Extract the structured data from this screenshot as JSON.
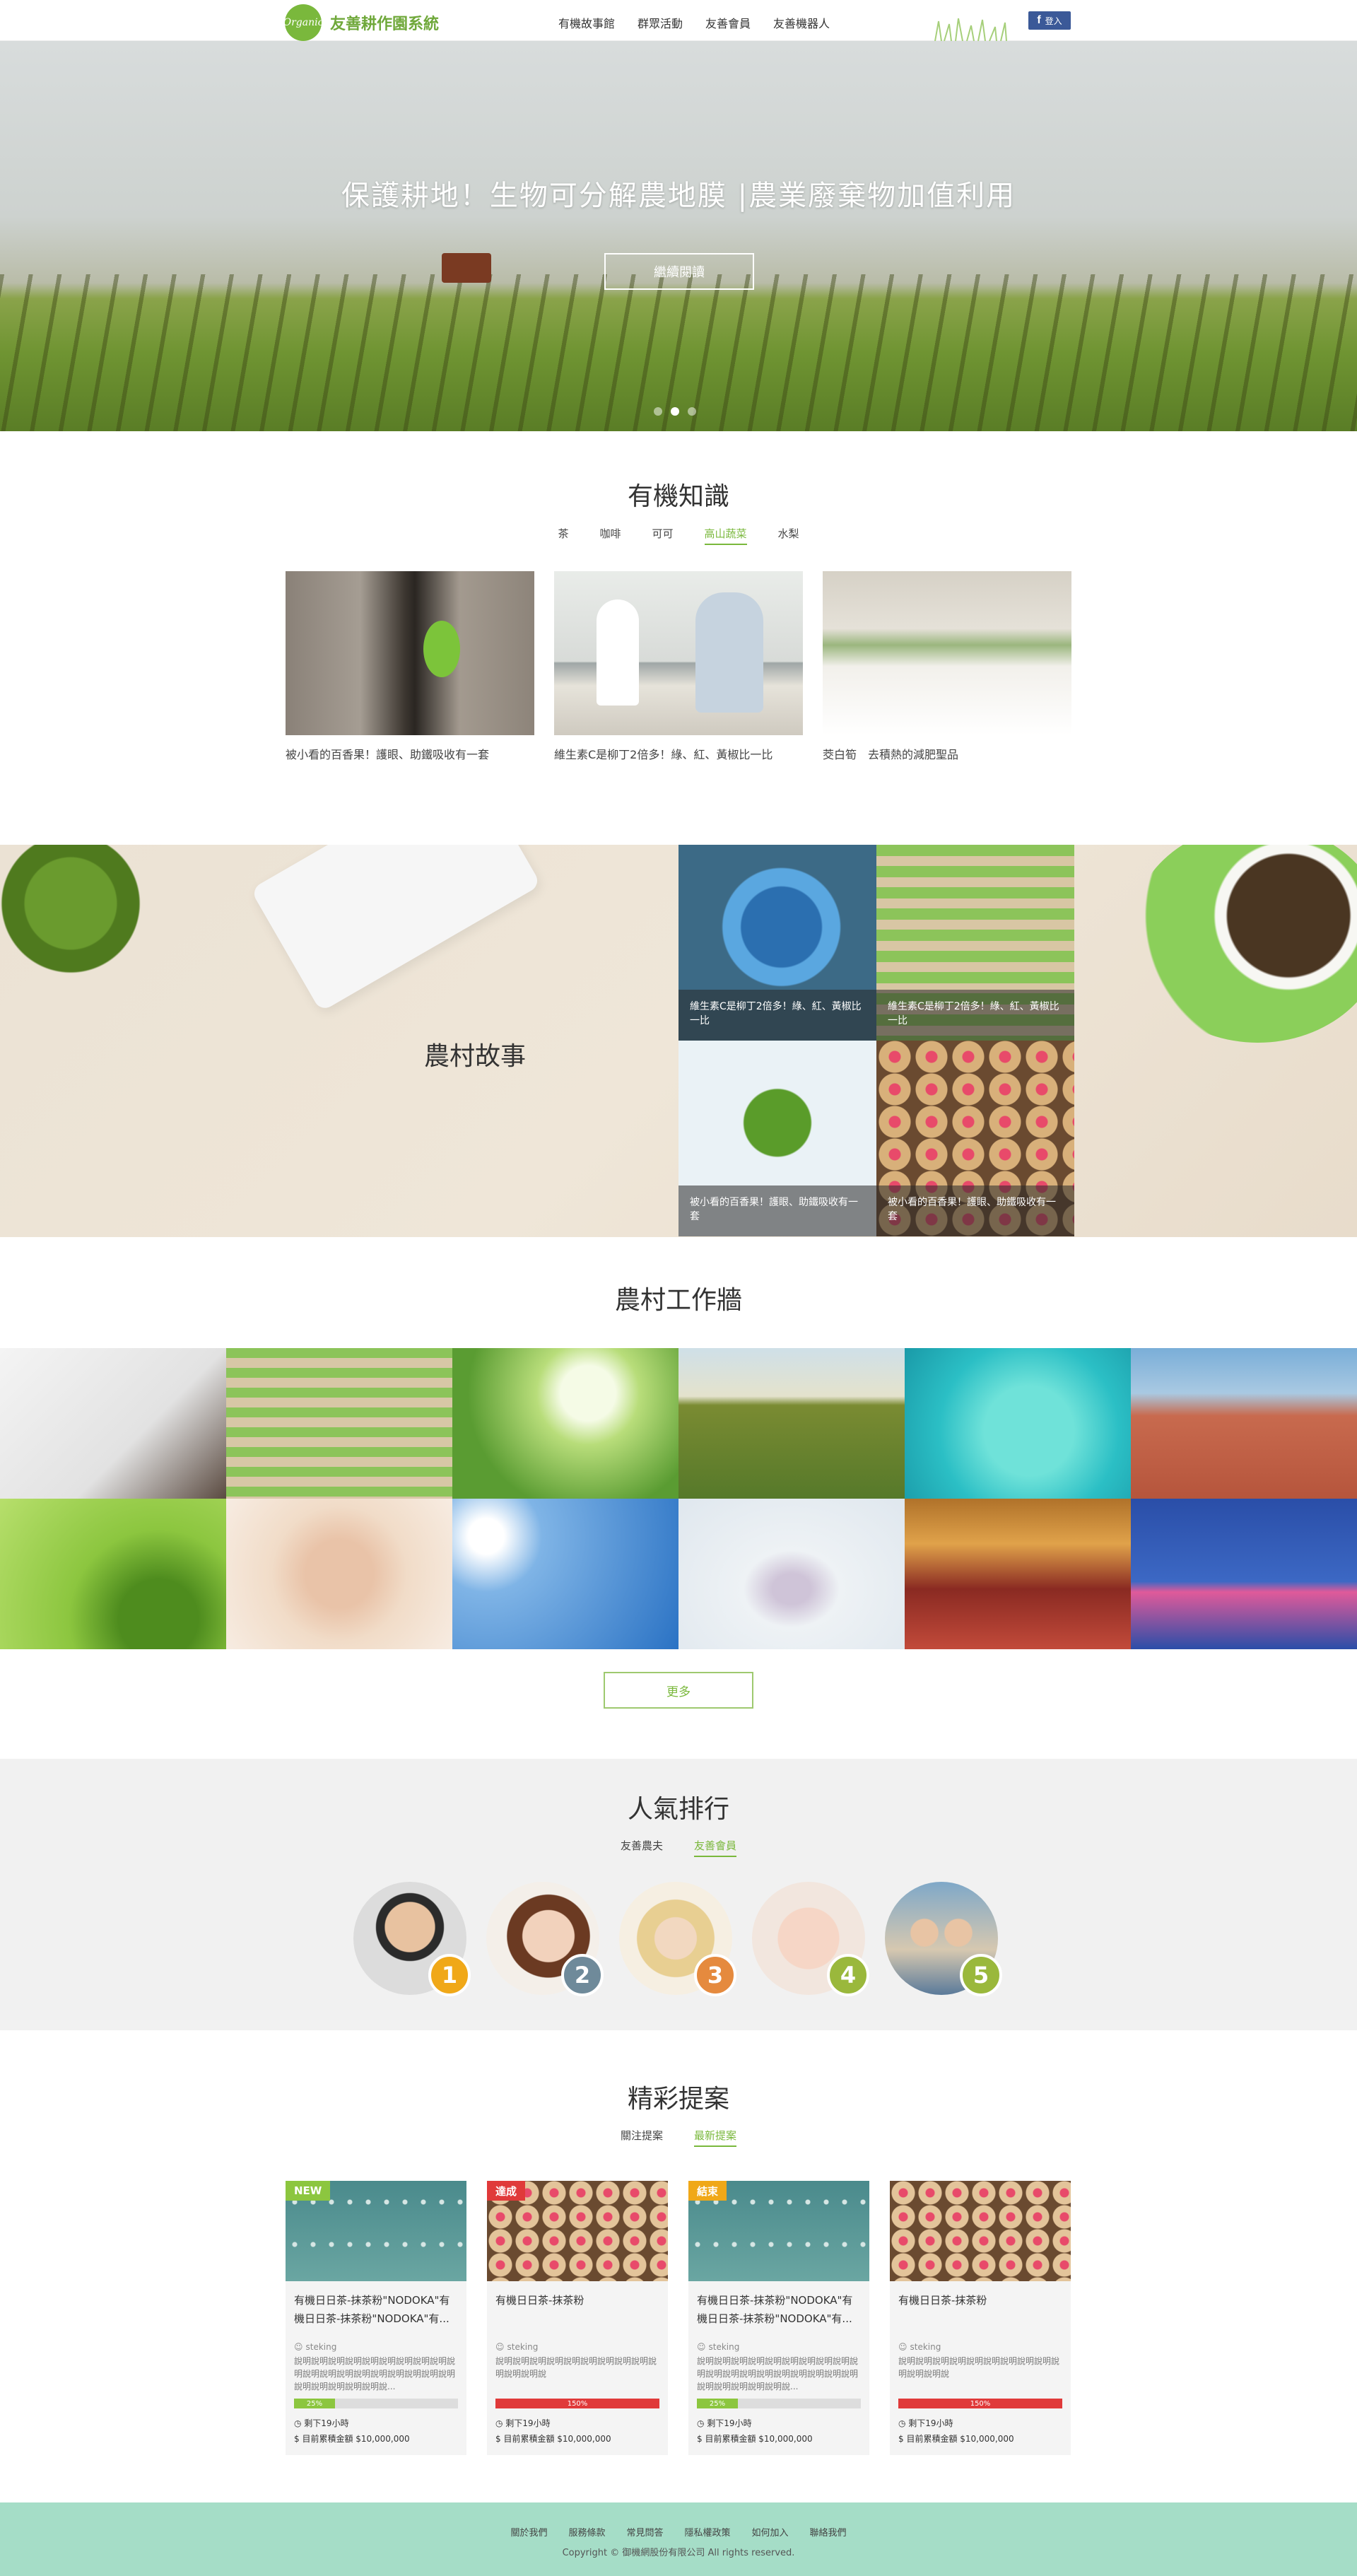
{
  "header": {
    "logo_mark": "Organic",
    "logo_text": "友善耕作園系統",
    "nav": [
      "有機故事館",
      "群眾活動",
      "友善會員",
      "友善機器人"
    ],
    "login_label": "登入"
  },
  "hero": {
    "title": "保護耕地！生物可分解農地膜 |農業廢棄物加值利用",
    "button_label": "繼續閱讀"
  },
  "knowledge": {
    "title": "有機知識",
    "tabs": [
      "茶",
      "咖啡",
      "可可",
      "高山蔬菜",
      "水梨"
    ],
    "active_tab": "高山蔬菜",
    "cards": [
      "被小看的百香果！護眼、助鐵吸收有一套",
      "維生素C是柳丁2倍多！綠、紅、黃椒比一比",
      "茭白筍　去積熱的減肥聖品"
    ]
  },
  "stories": {
    "title": "農村故事",
    "tiles": [
      "維生素C是柳丁2倍多！綠、紅、黃椒比一比",
      "維生素C是柳丁2倍多！綠、紅、黃椒比一比",
      "被小看的百香果！護眼、助鐵吸收有一套",
      "被小看的百香果！護眼、助鐵吸收有一套"
    ]
  },
  "workwall": {
    "title": "農村工作牆",
    "more_label": "更多"
  },
  "ranking": {
    "title": "人氣排行",
    "tabs": [
      "友善農夫",
      "友善會員"
    ],
    "active_tab": "友善會員",
    "ranks": [
      "1",
      "2",
      "3",
      "4",
      "5"
    ]
  },
  "proposals": {
    "title": "精彩提案",
    "tabs": [
      "關注提案",
      "最新提案"
    ],
    "active_tab": "最新提案",
    "cards": [
      {
        "tag": "NEW",
        "title": "有機日日茶-抹茶粉\"NODOKA\"有機日日茶-抹茶粉\"NODOKA\"有...",
        "user": "steking",
        "desc": "說明說明說明說明說明說明說明說明說明說明說明說明說明說明說明說明說明說明說明說明說明說明說明說明說...",
        "progress_label": "25%",
        "progress": 0.25,
        "remaining": "剩下19小時",
        "amount": "目前累積金額 $10,000,000"
      },
      {
        "tag": "達成",
        "title": "有機日日茶-抹茶粉",
        "user": "steking",
        "desc": "說明說明說明說明說明說明說明說明說明說明說明說明說",
        "progress_label": "150%",
        "progress": 1.5,
        "remaining": "剩下19小時",
        "amount": "目前累積金額 $10,000,000"
      },
      {
        "tag": "結束",
        "title": "有機日日茶-抹茶粉\"NODOKA\"有機日日茶-抹茶粉\"NODOKA\"有...",
        "user": "steking",
        "desc": "說明說明說明說明說明說明說明說明說明說明說明說明說明說明說明說明說明說明說明說明說明說明說明說明說...",
        "progress_label": "25%",
        "progress": 0.25,
        "remaining": "剩下19小時",
        "amount": "目前累積金額 $10,000,000"
      },
      {
        "tag": "",
        "title": "有機日日茶-抹茶粉",
        "user": "steking",
        "desc": "說明說明說明說明說明說明說明說明說明說明說明說明說",
        "progress_label": "150%",
        "progress": 1.5,
        "remaining": "剩下19小時",
        "amount": "目前累積金額 $10,000,000"
      }
    ]
  },
  "footer": {
    "links": [
      "關於我們",
      "服務條款",
      "常見問答",
      "隱私權政策",
      "如何加入",
      "聯絡我們"
    ],
    "copyright": "Copyright © 御機網股份有限公司 All rights reserved."
  },
  "colors": {
    "brand_green": "#7ab83c",
    "progress_green": "#8cc63f",
    "progress_red": "#e03a3a",
    "footer_bg": "#a5ddc7",
    "rank_badges": [
      "#f0a818",
      "#6f8a9a",
      "#e58a3e",
      "#9ab83c",
      "#9ab83c"
    ],
    "tag_colors": [
      "#8cc63f",
      "#e03a3a",
      "#f0a818",
      ""
    ]
  }
}
